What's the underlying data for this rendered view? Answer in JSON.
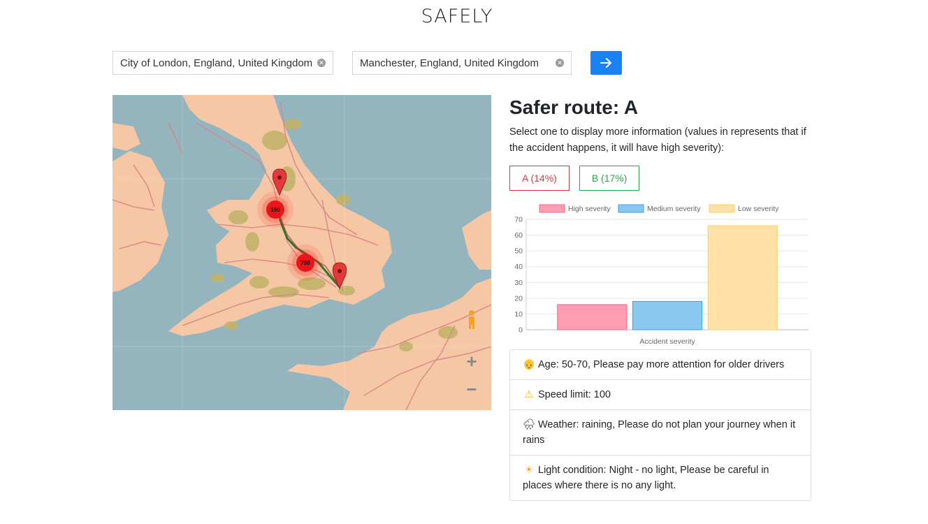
{
  "app": {
    "title": "SAFELY"
  },
  "search": {
    "origin_value": "City of London, England, United Kingdom",
    "destination_value": "Manchester, England, United Kingdom",
    "go_icon": "arrow-right-icon"
  },
  "map": {
    "markers": [
      {
        "label": "190",
        "type": "accident-cluster"
      },
      {
        "label": "750",
        "type": "accident-cluster"
      }
    ],
    "pins": [
      "destination-pin",
      "origin-pin"
    ],
    "controls": {
      "zoom_in": "+",
      "zoom_out": "−"
    },
    "colors": {
      "sea": "#94b5be",
      "land": "#f5c7a5",
      "route": "#2b7a2b",
      "cluster": "#e8151a"
    }
  },
  "result": {
    "title": "Safer route: A",
    "description": "Select one to display more information (values in represents that if the accident happens, it will have high severity):",
    "routes": [
      {
        "label": "A (14%)",
        "color": "#dc3545"
      },
      {
        "label": "B (17%)",
        "color": "#28a745"
      }
    ]
  },
  "chart_data": {
    "type": "bar",
    "categories": [
      ""
    ],
    "series": [
      {
        "name": "High severity",
        "values": [
          16
        ],
        "color": "#ff9db5",
        "border": "#ff6384"
      },
      {
        "name": "Medium severity",
        "values": [
          18
        ],
        "color": "#8ac8ef",
        "border": "#36a2eb"
      },
      {
        "name": "Low severity",
        "values": [
          66
        ],
        "color": "#ffe0a6",
        "border": "#ffce56"
      }
    ],
    "title": "",
    "xlabel": "Accident severity",
    "ylabel": "",
    "ylim": [
      0,
      70
    ],
    "yticks": [
      0,
      10,
      20,
      30,
      40,
      50,
      60,
      70
    ],
    "grid": true,
    "legend": "top"
  },
  "info": [
    {
      "icon": "older-person-icon",
      "glyph": "👴",
      "text": "Age: 50-70, Please pay more attention for older drivers"
    },
    {
      "icon": "warning-icon",
      "glyph": "⚠",
      "text": "Speed limit: 100"
    },
    {
      "icon": "rain-cloud-icon",
      "glyph": "🌧",
      "text": "Weather: raining, Please do not plan your journey when it rains"
    },
    {
      "icon": "sun-icon",
      "glyph": "☀",
      "text": "Light condition: Night - no light, Please be careful in places where there is no any light."
    }
  ]
}
